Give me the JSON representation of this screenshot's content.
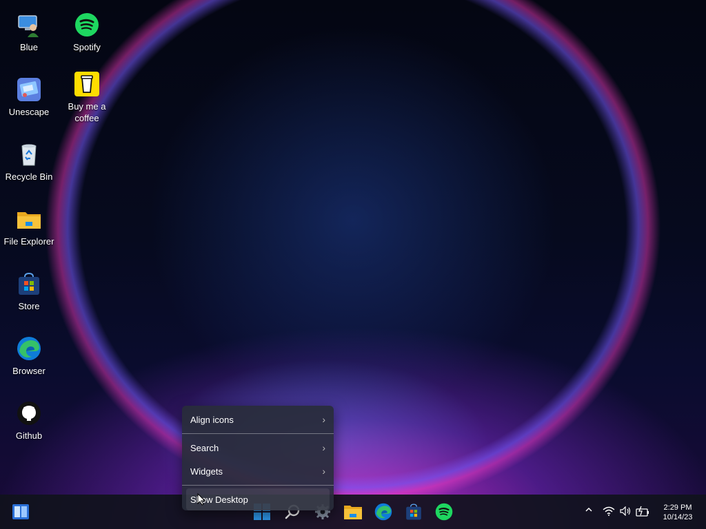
{
  "desktop_icons": [
    {
      "label": "Blue",
      "icon": "user-monitor-icon"
    },
    {
      "label": "Spotify",
      "icon": "spotify-icon"
    },
    {
      "label": "Unescape",
      "icon": "unescape-app-icon"
    },
    {
      "label": "Buy me a coffee",
      "icon": "coffee-cup-icon"
    },
    {
      "label": "Recycle Bin",
      "icon": "recycle-bin-icon"
    },
    {
      "label": "File Explorer",
      "icon": "folder-icon"
    },
    {
      "label": "Store",
      "icon": "store-bag-icon"
    },
    {
      "label": "Browser",
      "icon": "edge-browser-icon"
    },
    {
      "label": "Github",
      "icon": "github-icon"
    }
  ],
  "context_menu": {
    "items": [
      {
        "label": "Align icons",
        "has_submenu": true
      },
      {
        "label": "Search",
        "has_submenu": true
      },
      {
        "label": "Widgets",
        "has_submenu": true
      },
      {
        "label": "Show Desktop",
        "has_submenu": false
      }
    ]
  },
  "taskbar": {
    "apps": [
      "widgets-icon",
      "start-icon",
      "search-icon",
      "settings-icon",
      "file-explorer-icon",
      "edge-icon",
      "store-icon",
      "spotify-icon"
    ],
    "tray": {
      "chevron": "^",
      "icons": [
        "wifi-icon",
        "volume-icon",
        "battery-icon"
      ]
    },
    "clock": {
      "time": "2:29 PM",
      "date": "10/14/23"
    }
  },
  "colors": {
    "spotify_green": "#1ED760",
    "coffee_yellow": "#FFDD00",
    "folder_yellow": "#F8C23A",
    "windows_blue": "#2F9BF0",
    "edge_blue": "#0F7CD8",
    "edge_green": "#35C168"
  }
}
